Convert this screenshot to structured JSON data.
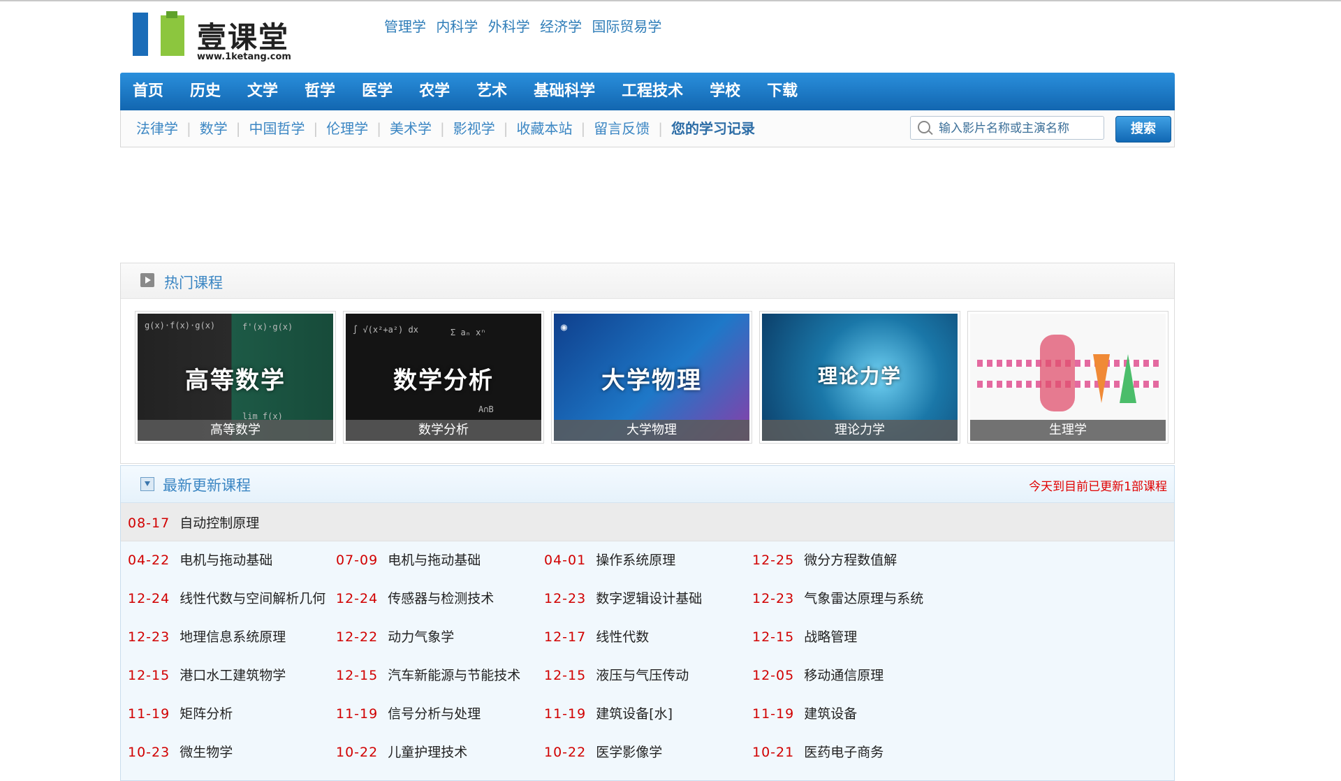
{
  "header": {
    "logo_name": "壹课堂",
    "logo_url": "www.1ketang.com",
    "top_links": [
      "管理学",
      "内科学",
      "外科学",
      "经济学",
      "国际贸易学"
    ]
  },
  "nav": {
    "main": [
      "首页",
      "历史",
      "文学",
      "哲学",
      "医学",
      "农学",
      "艺术",
      "基础科学",
      "工程技术",
      "学校",
      "下载"
    ],
    "sub": [
      "法律学",
      "数学",
      "中国哲学",
      "伦理学",
      "美术学",
      "影视学",
      "收藏本站",
      "留言反馈",
      "您的学习记录"
    ],
    "search_placeholder": "输入影片名称或主演名称",
    "search_button": "搜索"
  },
  "hot": {
    "title": "热门课程",
    "courses": [
      {
        "image_text": "高等数学",
        "caption": "高等数学"
      },
      {
        "image_text": "数学分析",
        "caption": "数学分析"
      },
      {
        "image_text": "大学物理",
        "caption": "大学物理"
      },
      {
        "image_text": "理论力学",
        "caption": "理论力学"
      },
      {
        "image_text": "",
        "caption": "生理学"
      }
    ]
  },
  "latest": {
    "title": "最新更新课程",
    "note": "今天到目前已更新1部课程",
    "highlight": {
      "date": "08-17",
      "name": "自动控制原理"
    },
    "rows": [
      [
        {
          "date": "04-22",
          "name": "电机与拖动基础"
        },
        {
          "date": "07-09",
          "name": "电机与拖动基础"
        },
        {
          "date": "04-01",
          "name": "操作系统原理"
        },
        {
          "date": "12-25",
          "name": "微分方程数值解"
        }
      ],
      [
        {
          "date": "12-24",
          "name": "线性代数与空间解析几何"
        },
        {
          "date": "12-24",
          "name": "传感器与检测技术"
        },
        {
          "date": "12-23",
          "name": "数字逻辑设计基础"
        },
        {
          "date": "12-23",
          "name": "气象雷达原理与系统"
        }
      ],
      [
        {
          "date": "12-23",
          "name": "地理信息系统原理"
        },
        {
          "date": "12-22",
          "name": "动力气象学"
        },
        {
          "date": "12-17",
          "name": "线性代数"
        },
        {
          "date": "12-15",
          "name": "战略管理"
        }
      ],
      [
        {
          "date": "12-15",
          "name": "港口水工建筑物学"
        },
        {
          "date": "12-15",
          "name": "汽车新能源与节能技术"
        },
        {
          "date": "12-15",
          "name": "液压与气压传动"
        },
        {
          "date": "12-05",
          "name": "移动通信原理"
        }
      ],
      [
        {
          "date": "11-19",
          "name": "矩阵分析"
        },
        {
          "date": "11-19",
          "name": "信号分析与处理"
        },
        {
          "date": "11-19",
          "name": "建筑设备[水]"
        },
        {
          "date": "11-19",
          "name": "建筑设备"
        }
      ],
      [
        {
          "date": "10-23",
          "name": "微生物学"
        },
        {
          "date": "10-22",
          "name": "儿童护理技术"
        },
        {
          "date": "10-22",
          "name": "医学影像学"
        },
        {
          "date": "10-21",
          "name": "医药电子商务"
        }
      ]
    ]
  },
  "colors": {
    "nav_blue": "#1a7ccc",
    "date_red": "#d10000",
    "link_blue": "#3b86c3"
  }
}
